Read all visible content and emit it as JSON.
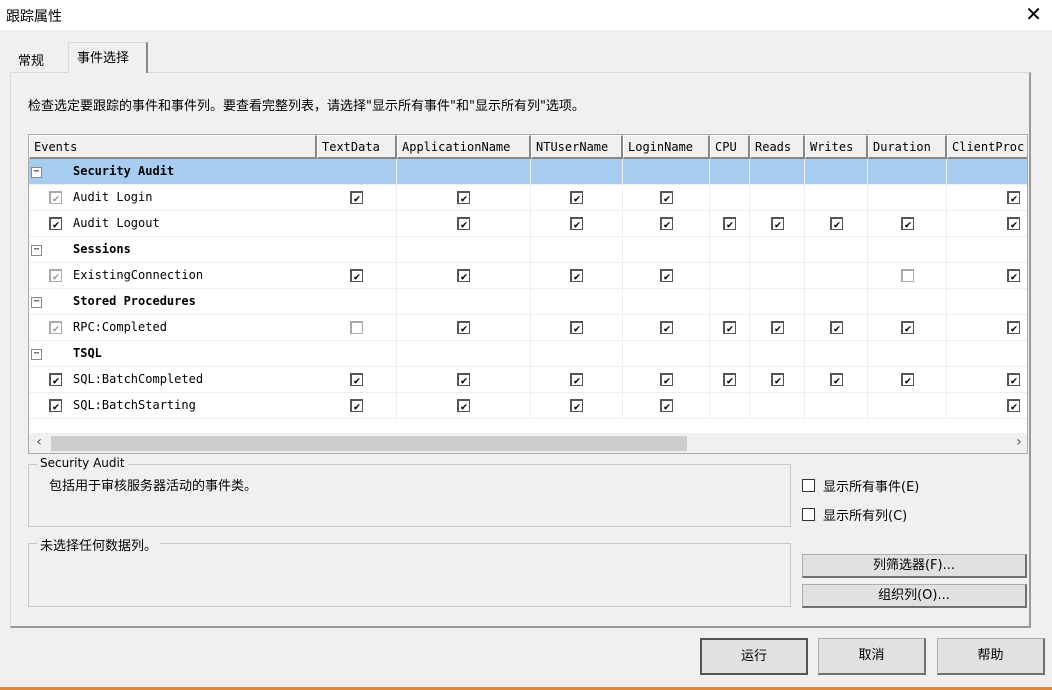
{
  "window": {
    "title": "跟踪属性"
  },
  "tabs": [
    {
      "label": "常规"
    },
    {
      "label": "事件选择"
    }
  ],
  "hint": "检查选定要跟踪的事件和事件列。要查看完整列表，请选择\"显示所有事件\"和\"显示所有列\"选项。",
  "grid": {
    "columns": [
      "Events",
      "TextData",
      "ApplicationName",
      "NTUserName",
      "LoginName",
      "CPU",
      "Reads",
      "Writes",
      "Duration",
      "ClientProc"
    ],
    "rows": [
      {
        "type": "group",
        "label": "Security Audit",
        "selected": true
      },
      {
        "type": "event",
        "label": "Audit Login",
        "event_check": "gray",
        "cells": [
          "1",
          "1",
          "1",
          "1",
          "",
          "",
          "",
          "",
          "1"
        ]
      },
      {
        "type": "event",
        "label": "Audit Logout",
        "event_check": "1",
        "cells": [
          "",
          "1",
          "1",
          "1",
          "1",
          "1",
          "1",
          "1",
          "1"
        ]
      },
      {
        "type": "group",
        "label": "Sessions"
      },
      {
        "type": "event",
        "label": "ExistingConnection",
        "event_check": "gray",
        "cells": [
          "1",
          "1",
          "1",
          "1",
          "",
          "",
          "",
          "0",
          "1"
        ]
      },
      {
        "type": "group",
        "label": "Stored Procedures"
      },
      {
        "type": "event",
        "label": "RPC:Completed",
        "event_check": "gray",
        "cells": [
          "0",
          "1",
          "1",
          "1",
          "1",
          "1",
          "1",
          "1",
          "1"
        ]
      },
      {
        "type": "group",
        "label": "TSQL"
      },
      {
        "type": "event",
        "label": "SQL:BatchCompleted",
        "event_check": "1",
        "cells": [
          "1",
          "1",
          "1",
          "1",
          "1",
          "1",
          "1",
          "1",
          "1"
        ]
      },
      {
        "type": "event",
        "label": "SQL:BatchStarting",
        "event_check": "1",
        "cells": [
          "1",
          "1",
          "1",
          "1",
          "",
          "",
          "",
          "",
          "1"
        ]
      }
    ]
  },
  "description_box": {
    "title": "Security Audit",
    "text": "包括用于审核服务器活动的事件类。"
  },
  "column_box": {
    "title": "未选择任何数据列。"
  },
  "options": {
    "show_all_events": "显示所有事件(E)",
    "show_all_columns": "显示所有列(C)"
  },
  "buttons": {
    "column_filters": "列筛选器(F)...",
    "organize_columns": "组织列(O)...",
    "run": "运行",
    "cancel": "取消",
    "help": "帮助"
  }
}
